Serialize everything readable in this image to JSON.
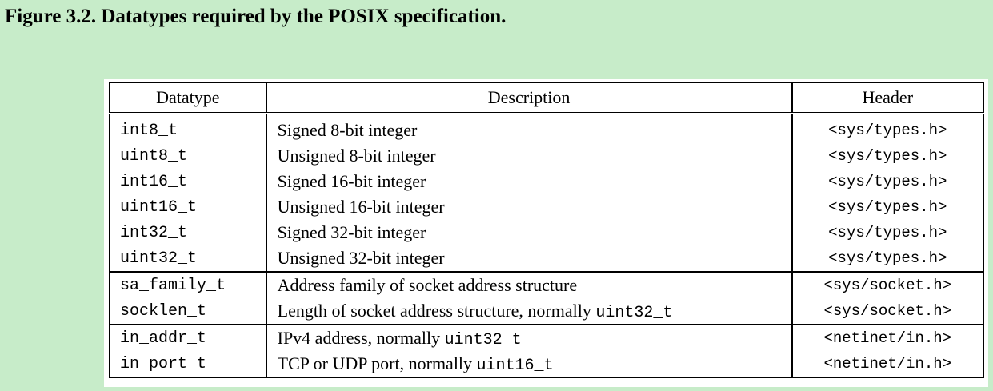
{
  "caption": "Figure 3.2. Datatypes required by the POSIX specification.",
  "table": {
    "headers": {
      "datatype": "Datatype",
      "description": "Description",
      "header": "Header"
    },
    "rows": [
      {
        "datatype": "int8_t",
        "description": "Signed 8-bit integer",
        "description_code": "",
        "header": "<sys/types.h>"
      },
      {
        "datatype": "uint8_t",
        "description": "Unsigned 8-bit integer",
        "description_code": "",
        "header": "<sys/types.h>"
      },
      {
        "datatype": "int16_t",
        "description": "Signed 16-bit integer",
        "description_code": "",
        "header": "<sys/types.h>"
      },
      {
        "datatype": "uint16_t",
        "description": "Unsigned 16-bit integer",
        "description_code": "",
        "header": "<sys/types.h>"
      },
      {
        "datatype": "int32_t",
        "description": "Signed 32-bit integer",
        "description_code": "",
        "header": "<sys/types.h>"
      },
      {
        "datatype": "uint32_t",
        "description": "Unsigned 32-bit integer",
        "description_code": "",
        "header": "<sys/types.h>"
      },
      {
        "datatype": "sa_family_t",
        "description": "Address family of socket address structure",
        "description_code": "",
        "header": "<sys/socket.h>"
      },
      {
        "datatype": "socklen_t",
        "description": "Length of socket address structure, normally ",
        "description_code": "uint32_t",
        "header": "<sys/socket.h>"
      },
      {
        "datatype": "in_addr_t",
        "description": "IPv4 address, normally ",
        "description_code": "uint32_t",
        "header": "<netinet/in.h>"
      },
      {
        "datatype": "in_port_t",
        "description": "TCP or UDP port, normally ",
        "description_code": "uint16_t",
        "header": "<netinet/in.h>"
      }
    ]
  }
}
